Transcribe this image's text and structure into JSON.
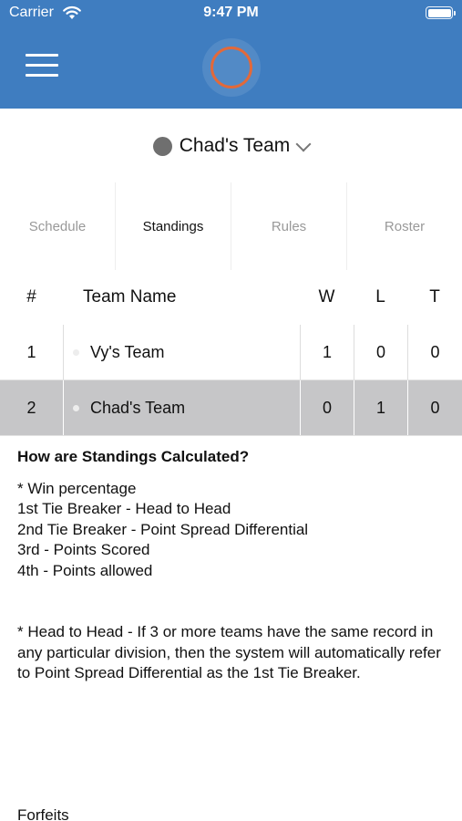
{
  "status_bar": {
    "carrier": "Carrier",
    "time": "9:47 PM"
  },
  "header": {
    "logo": "team-logo-ring",
    "accent_color": "#3f7dc0"
  },
  "team_selector": {
    "team_name": "Chad's Team"
  },
  "tabs": [
    {
      "label": "Schedule",
      "active": false
    },
    {
      "label": "Standings",
      "active": true
    },
    {
      "label": "Rules",
      "active": false
    },
    {
      "label": "Roster",
      "active": false
    }
  ],
  "table": {
    "headers": {
      "rank": "#",
      "team": "Team Name",
      "w": "W",
      "l": "L",
      "t": "T"
    },
    "rows": [
      {
        "rank": "1",
        "team": "Vy's Team",
        "w": "1",
        "l": "0",
        "t": "0"
      },
      {
        "rank": "2",
        "team": "Chad's Team",
        "w": "0",
        "l": "1",
        "t": "0",
        "highlighted": true
      }
    ]
  },
  "info": {
    "title": "How are Standings Calculated?",
    "lines": [
      "* Win percentage",
      "1st Tie Breaker - Head to Head",
      "2nd Tie Breaker - Point Spread Differential",
      "3rd - Points Scored",
      "4th - Points allowed"
    ],
    "note": "* Head to Head - If 3 or more teams have the same record in any particular division, then the system will automatically refer to Point Spread Differential as the 1st Tie Breaker.",
    "footer_partial": "Forfeits"
  }
}
